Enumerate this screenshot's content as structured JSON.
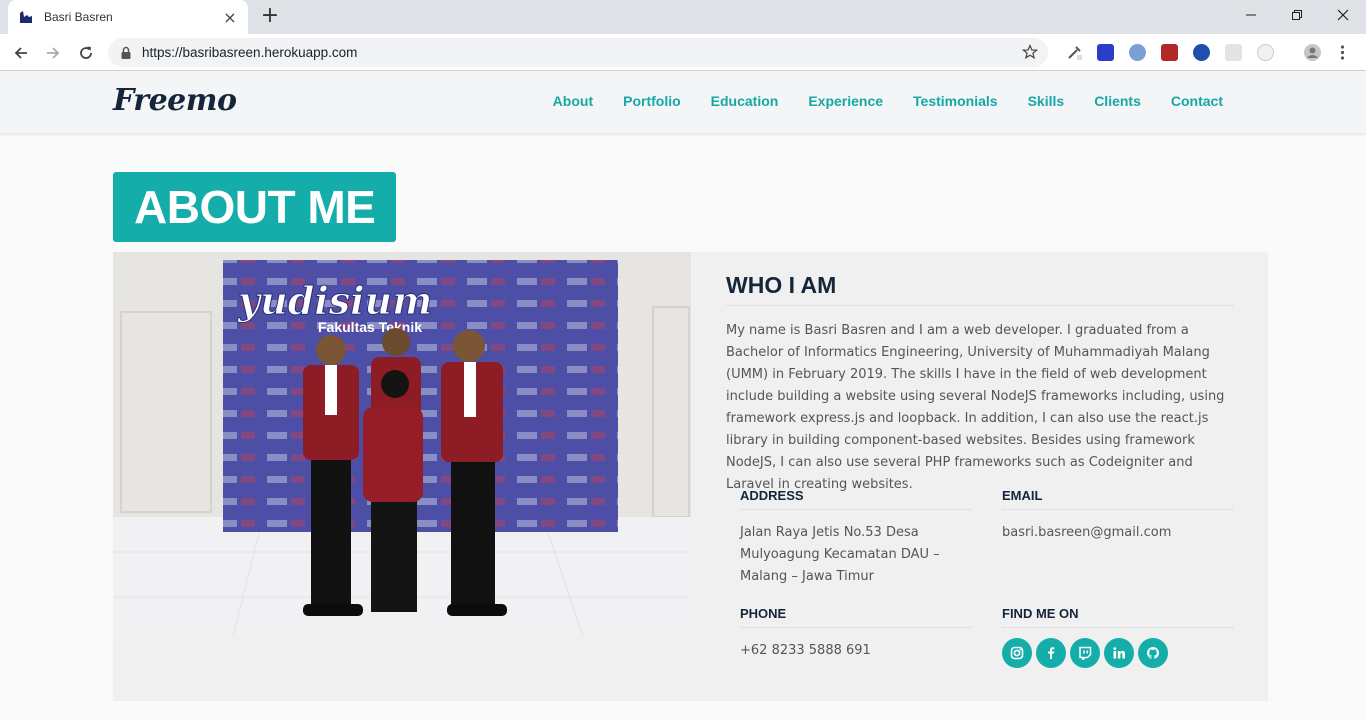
{
  "browser": {
    "tab_title": "Basri Basren",
    "tab_close": "×",
    "new_tab": "+",
    "url": "https://basribasreen.herokuapp.com",
    "window_controls": [
      "minimize",
      "restore",
      "close"
    ]
  },
  "site": {
    "logo": "Freemo",
    "nav": [
      "About",
      "Portfolio",
      "Education",
      "Experience",
      "Testimonials",
      "Skills",
      "Clients",
      "Contact"
    ],
    "accent_color": "#14adaa",
    "dark_color": "#15263a"
  },
  "about": {
    "section_title": "ABOUT ME",
    "who_title": "WHO I AM",
    "who_body": "My name is Basri Basren and I am a web developer. I graduated from a Bachelor of Informatics Engineering, University of Muhammadiyah Malang (UMM) in February 2019. The skills I have in the field of web development include building a website using several NodeJS frameworks including, using framework express.js and loopback. In addition, I can also use the react.js library in building component-based websites. Besides using framework NodeJS, I can also use several PHP frameworks such as Codeigniter and Laravel in creating websites.",
    "address_label": "ADDRESS",
    "address_value": "Jalan Raya Jetis No.53 Desa Mulyoagung Kecamatan DAU – Malang – Jawa Timur",
    "email_label": "EMAIL",
    "email_value": "basri.basreen@gmail.com",
    "phone_label": "PHONE",
    "phone_value": "+62 8233 5888 691",
    "social_label": "FIND ME ON",
    "socials": [
      "instagram-icon",
      "facebook-icon",
      "twitch-icon",
      "linkedin-icon",
      "github-icon"
    ],
    "photo_banner": "yudisium",
    "photo_banner_sub": "Fakultas Teknik"
  }
}
